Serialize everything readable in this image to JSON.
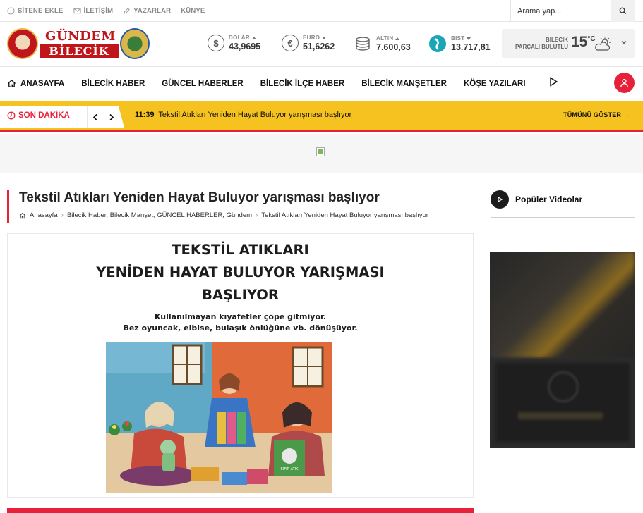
{
  "topbar": {
    "links": [
      {
        "label": "SİTENE EKLE",
        "icon": "plus-circle-icon"
      },
      {
        "label": "İLETİŞİM",
        "icon": "envelope-icon"
      },
      {
        "label": "YAZARLAR",
        "icon": "pen-icon"
      },
      {
        "label": "KÜNYE",
        "icon": ""
      }
    ],
    "search_placeholder": "Arama yap..."
  },
  "logo": {
    "line1": "GÜNDEM",
    "line2": "BİLECİK"
  },
  "markets": [
    {
      "label": "DOLAR",
      "value": "43,9695",
      "trend": "up",
      "icon": "$"
    },
    {
      "label": "EURO",
      "value": "51,6262",
      "trend": "down",
      "icon": "€"
    },
    {
      "label": "ALTIN",
      "value": "7.600,63",
      "trend": "up",
      "icon": "gold"
    },
    {
      "label": "BIST",
      "value": "13.717,81",
      "trend": "down",
      "icon": "bist"
    }
  ],
  "weather": {
    "city": "BİLECİK",
    "condition": "PARÇALI BULUTLU",
    "temp": "15",
    "unit": "°C"
  },
  "nav": {
    "home": "ANASAYFA",
    "items": [
      "BİLECİK HABER",
      "GÜNCEL HABERLER",
      "BİLECİK İLÇE HABER",
      "BİLECİK MANŞETLER",
      "KÖŞE YAZILARI"
    ]
  },
  "breaking": {
    "label": "SON DAKİKA",
    "time": "11:39",
    "headline": "Tekstil Atıkları Yeniden Hayat Buluyor yarışması başlıyor",
    "show_all": "TÜMÜNÜ GÖSTER →"
  },
  "article": {
    "title": "Tekstil Atıkları Yeniden Hayat Buluyor yarışması başlıyor",
    "breadcrumb": {
      "home": "Anasayfa",
      "categories": "Bilecik Haber, Bilecik Manşet, GÜNCEL HABERLER, Gündem",
      "current": "Tekstil Atıkları Yeniden Hayat Buluyor yarışması başlıyor"
    },
    "poster": {
      "line1": "TEKSTİL ATIKLARI",
      "line2": "YENİDEN HAYAT BULUYOR YARIŞMASI",
      "line3": "BAŞLIYOR",
      "sub1": "Kullanılmayan kıyafetler çöpe gitmiyor.",
      "sub2": "Bez oyuncak, elbise, bulaşık önlüğüne vb. dönüşüyor.",
      "bag_text": "SIFIR ATIK"
    }
  },
  "sidebar": {
    "title": "Popüler Videolar"
  },
  "colors": {
    "accent": "#e8213b",
    "breaking_bg": "#f5c220"
  }
}
